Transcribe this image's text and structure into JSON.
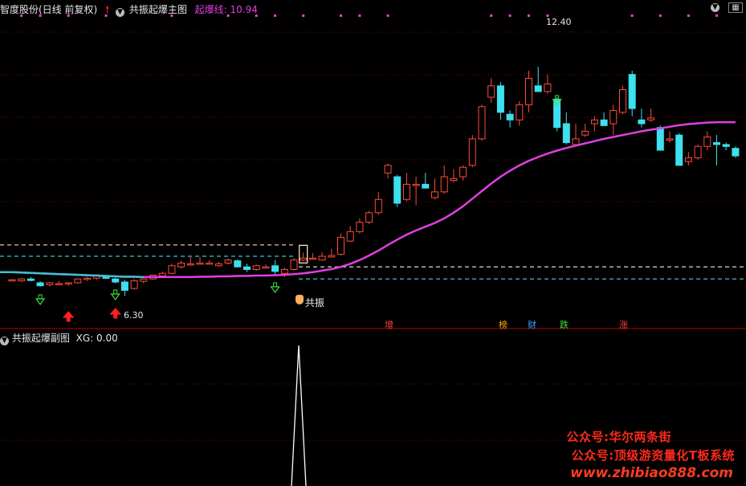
{
  "header": {
    "title": "智度股份(日线 前复权)",
    "indicator_name": "共振起爆主图",
    "line_label": "起爆线: 10.94",
    "colors": {
      "title": "#e6e6e6",
      "indicator_line": "#e040e0",
      "up_arrow": "#ff2020"
    }
  },
  "sub_panel": {
    "title": "共振起爆副图",
    "xg_label": "XG: 0.00",
    "xg_values": [
      0,
      1,
      0
    ]
  },
  "annotations": {
    "high_label": "12.40",
    "low_label": "6.30",
    "signal_label": "共振",
    "tags": [
      {
        "text": "增",
        "color": "#ff4040"
      },
      {
        "text": "榜",
        "color": "#ffb000"
      },
      {
        "text": "财",
        "color": "#40a0ff"
      },
      {
        "text": "跌",
        "color": "#40e040"
      },
      {
        "text": "涨",
        "color": "#ff4040"
      }
    ]
  },
  "watermark": {
    "line1": "公众号:华尔两条街",
    "line2": "公众号:顶级游资量化T板系统",
    "line3": "www.zhibiao888.com"
  },
  "chart_data": {
    "type": "candlestick",
    "ylim": [
      6.0,
      13.0
    ],
    "candles": [
      [
        6.77,
        6.8,
        6.75,
        6.78
      ],
      [
        6.75,
        6.83,
        6.72,
        6.8
      ],
      [
        6.8,
        6.85,
        6.74,
        6.76
      ],
      [
        6.7,
        6.74,
        6.6,
        6.62
      ],
      [
        6.65,
        6.72,
        6.6,
        6.7
      ],
      [
        6.68,
        6.75,
        6.63,
        6.68
      ],
      [
        6.67,
        6.72,
        6.62,
        6.7
      ],
      [
        6.7,
        6.82,
        6.68,
        6.8
      ],
      [
        6.8,
        6.85,
        6.75,
        6.82
      ],
      [
        6.82,
        6.92,
        6.78,
        6.88
      ],
      [
        6.85,
        6.88,
        6.8,
        6.82
      ],
      [
        6.8,
        6.83,
        6.68,
        6.72
      ],
      [
        6.72,
        6.78,
        6.35,
        6.5
      ],
      [
        6.55,
        6.8,
        6.52,
        6.75
      ],
      [
        6.74,
        6.82,
        6.68,
        6.8
      ],
      [
        6.8,
        6.92,
        6.78,
        6.9
      ],
      [
        6.88,
        7.0,
        6.84,
        6.95
      ],
      [
        6.95,
        7.2,
        6.92,
        7.15
      ],
      [
        7.12,
        7.28,
        7.08,
        7.22
      ],
      [
        7.18,
        7.38,
        7.15,
        7.2
      ],
      [
        7.22,
        7.38,
        7.18,
        7.22
      ],
      [
        7.2,
        7.3,
        7.18,
        7.22
      ],
      [
        7.15,
        7.25,
        7.12,
        7.2
      ],
      [
        7.22,
        7.34,
        7.18,
        7.3
      ],
      [
        7.28,
        7.32,
        7.1,
        7.12
      ],
      [
        7.12,
        7.2,
        6.98,
        7.05
      ],
      [
        7.05,
        7.18,
        7.02,
        7.15
      ],
      [
        7.12,
        7.18,
        7.1,
        7.12
      ],
      [
        7.15,
        7.3,
        6.9,
        7.0
      ],
      [
        6.95,
        7.1,
        6.85,
        7.05
      ],
      [
        7.05,
        7.35,
        7.02,
        7.3
      ],
      [
        7.3,
        7.5,
        7.28,
        7.35
      ],
      [
        7.35,
        7.48,
        7.32,
        7.35
      ],
      [
        7.3,
        7.5,
        7.28,
        7.4
      ],
      [
        7.38,
        7.6,
        7.36,
        7.42
      ],
      [
        7.45,
        8.0,
        7.42,
        7.9
      ],
      [
        7.8,
        8.2,
        7.78,
        8.05
      ],
      [
        8.05,
        8.4,
        8.0,
        8.3
      ],
      [
        8.3,
        8.6,
        8.25,
        8.55
      ],
      [
        8.55,
        9.1,
        8.5,
        8.9
      ],
      [
        9.6,
        9.85,
        9.45,
        9.8
      ],
      [
        9.5,
        9.55,
        8.7,
        8.8
      ],
      [
        8.9,
        9.6,
        8.85,
        9.3
      ],
      [
        9.3,
        9.5,
        8.75,
        9.3
      ],
      [
        9.3,
        9.6,
        9.2,
        9.2
      ],
      [
        8.95,
        9.45,
        8.9,
        9.1
      ],
      [
        9.1,
        9.8,
        9.05,
        9.5
      ],
      [
        9.4,
        9.7,
        9.35,
        9.45
      ],
      [
        9.5,
        9.8,
        9.4,
        9.75
      ],
      [
        9.8,
        10.6,
        9.75,
        10.5
      ],
      [
        10.5,
        11.4,
        10.45,
        11.35
      ],
      [
        11.6,
        12.1,
        11.45,
        11.9
      ],
      [
        11.9,
        12.0,
        11.0,
        11.2
      ],
      [
        11.15,
        11.25,
        10.8,
        11.0
      ],
      [
        11.0,
        11.5,
        10.85,
        11.4
      ],
      [
        11.4,
        12.3,
        11.2,
        12.1
      ],
      [
        11.9,
        12.4,
        11.8,
        11.75
      ],
      [
        11.75,
        12.2,
        11.7,
        11.95
      ],
      [
        11.55,
        11.6,
        10.7,
        10.8
      ],
      [
        10.9,
        11.2,
        10.35,
        10.4
      ],
      [
        10.35,
        10.9,
        10.3,
        10.5
      ],
      [
        10.6,
        10.9,
        10.55,
        10.7
      ],
      [
        10.9,
        11.1,
        10.7,
        11.0
      ],
      [
        11.0,
        11.2,
        10.85,
        10.85
      ],
      [
        10.9,
        11.4,
        10.6,
        11.25
      ],
      [
        11.2,
        11.9,
        11.15,
        11.8
      ],
      [
        12.2,
        12.3,
        11.1,
        11.3
      ],
      [
        11.0,
        11.3,
        10.8,
        10.9
      ],
      [
        11.0,
        11.3,
        10.95,
        11.05
      ],
      [
        10.8,
        10.85,
        10.2,
        10.2
      ],
      [
        10.5,
        10.7,
        10.4,
        10.5
      ],
      [
        10.6,
        10.65,
        9.8,
        9.8
      ],
      [
        9.9,
        10.15,
        9.8,
        10.0
      ],
      [
        10.0,
        10.35,
        9.95,
        10.3
      ],
      [
        10.3,
        10.7,
        10.2,
        10.55
      ],
      [
        10.4,
        10.6,
        9.8,
        10.35
      ],
      [
        10.35,
        10.4,
        10.2,
        10.3
      ],
      [
        10.25,
        10.3,
        10.0,
        10.05
      ]
    ],
    "series": [
      {
        "name": "起爆线",
        "color": "#e040e0",
        "values": [
          6.98,
          6.97,
          6.96,
          6.95,
          6.94,
          6.93,
          6.92,
          6.91,
          6.9,
          6.89,
          6.88,
          6.87,
          6.86,
          6.86,
          6.85,
          6.85,
          6.85,
          6.85,
          6.85,
          6.85,
          6.86,
          6.86,
          6.87,
          6.87,
          6.88,
          6.88,
          6.89,
          6.89,
          6.9,
          6.91,
          6.93,
          6.95,
          6.98,
          7.02,
          7.06,
          7.12,
          7.2,
          7.3,
          7.42,
          7.55,
          7.7,
          7.84,
          7.97,
          8.08,
          8.18,
          8.28,
          8.4,
          8.55,
          8.72,
          8.92,
          9.12,
          9.32,
          9.5,
          9.66,
          9.8,
          9.92,
          10.02,
          10.11,
          10.19,
          10.26,
          10.32,
          10.38,
          10.44,
          10.5,
          10.55,
          10.6,
          10.65,
          10.7,
          10.74,
          10.78,
          10.82,
          10.86,
          10.89,
          10.91,
          10.93,
          10.94,
          10.94,
          10.94
        ]
      }
    ],
    "h_levels": [
      {
        "value": 7.7,
        "color": "#d8c8a8"
      },
      {
        "value": 7.4,
        "color": "#40c0d0"
      },
      {
        "value": 7.12,
        "color": "#f0f0f0"
      },
      {
        "value": 6.8,
        "color": "#40c0d0"
      }
    ]
  }
}
